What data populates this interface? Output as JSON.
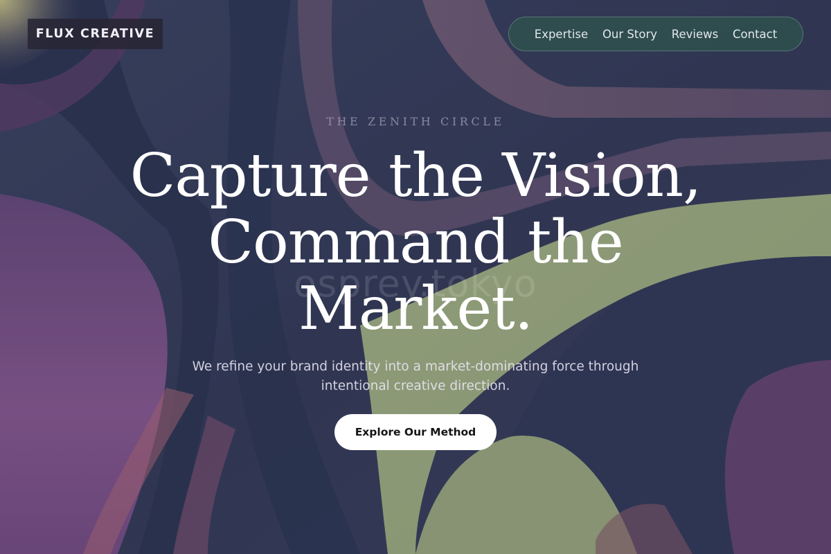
{
  "brand": {
    "name": "FLUX CREATIVE"
  },
  "nav": {
    "items": [
      {
        "label": "Expertise"
      },
      {
        "label": "Our Story"
      },
      {
        "label": "Reviews"
      },
      {
        "label": "Contact"
      }
    ]
  },
  "hero": {
    "eyebrow": "THE ZENITH CIRCLE",
    "headline_line1": "Capture the Vision,",
    "headline_line2": "Command the",
    "headline_line3": "Market.",
    "watermark": "osprey.tokyo",
    "subtitle": "We refine your brand identity into a market-dominating force through intentional creative direction.",
    "cta_label": "Explore Our Method"
  },
  "colors": {
    "background_dark": "#363a55",
    "accent_purple": "#7b4a86",
    "accent_green": "#a4b282",
    "nav_pill": "#2f4e4e",
    "cta_bg": "#ffffff",
    "cta_text": "#141414"
  }
}
